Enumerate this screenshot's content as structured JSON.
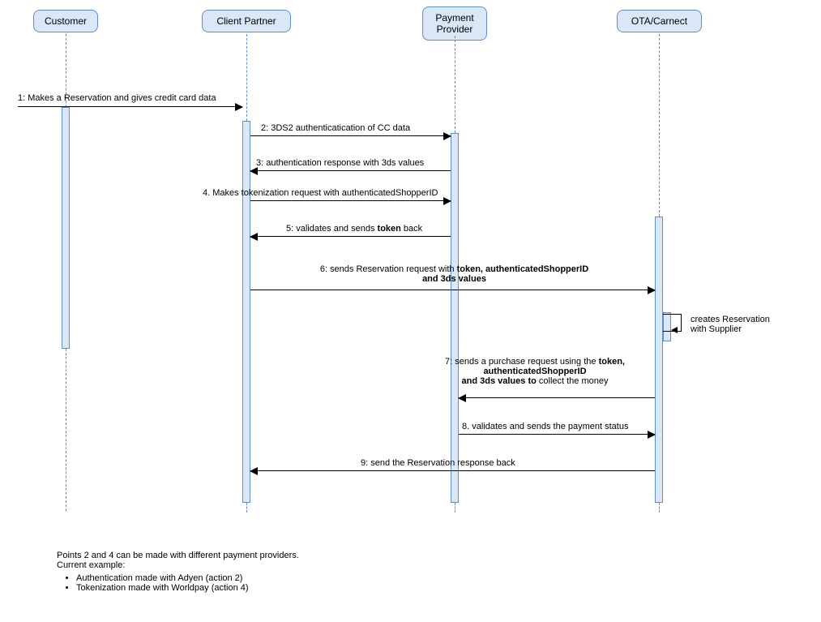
{
  "chart_data": {
    "type": "sequence-diagram",
    "participants": [
      "Customer",
      "Client Partner",
      "Payment Provider",
      "OTA/Carnect"
    ],
    "messages": [
      {
        "n": 1,
        "from": "Customer",
        "to": "Client Partner",
        "text": "1: Makes a Reservation and gives credit card data"
      },
      {
        "n": 2,
        "from": "Client Partner",
        "to": "Payment Provider",
        "text": "2: 3DS2 authenticatication of CC data"
      },
      {
        "n": 3,
        "from": "Payment Provider",
        "to": "Client Partner",
        "text": "3: authentication response with 3ds values"
      },
      {
        "n": 4,
        "from": "Client Partner",
        "to": "Payment Provider",
        "text": "4. Makes tokenization request with authenticatedShopperID"
      },
      {
        "n": 5,
        "from": "Payment Provider",
        "to": "Client Partner",
        "text": "5: validates and sends token back"
      },
      {
        "n": 6,
        "from": "Client Partner",
        "to": "OTA/Carnect",
        "text": "6: sends Reservation request with token, authenticatedShopperID and 3ds values"
      },
      {
        "n": -1,
        "from": "OTA/Carnect",
        "to": "OTA/Carnect",
        "text": "creates Reservation with Supplier"
      },
      {
        "n": 7,
        "from": "OTA/Carnect",
        "to": "Payment Provider",
        "text": "7: sends a purchase request using the token, authenticatedShopperID and 3ds values to collect the money"
      },
      {
        "n": 8,
        "from": "Payment Provider",
        "to": "OTA/Carnect",
        "text": "8. validates and sends the payment status"
      },
      {
        "n": 9,
        "from": "OTA/Carnect",
        "to": "Client Partner",
        "text": "9: send the Reservation response back"
      }
    ]
  },
  "p": {
    "customer": "Customer",
    "client": "Client Partner",
    "provider": "Payment\nProvider",
    "ota": "OTA/Carnect"
  },
  "m1": "1: Makes a Reservation and gives credit card data",
  "m2": "2: 3DS2 authenticatication of CC data",
  "m3": "3: authentication response with 3ds values",
  "m4": "4. Makes tokenization request with authenticatedShopperID",
  "m5_a": "5: validates and sends ",
  "m5_b": "token",
  "m5_c": " back",
  "m6_a": "6: sends Reservation request with ",
  "m6_b": "token, authenticatedShopperID",
  "m6_c": "and 3ds values",
  "self_a": "creates Reservation",
  "self_b": "with Supplier",
  "m7_a": "7: sends a purchase request using the ",
  "m7_b": "token,",
  "m7_c": "authenticatedShopperID",
  "m7_d": "and 3ds values to",
  "m7_e": " collect the money",
  "m8": "8. validates and sends the payment status",
  "m9": "9: send the Reservation response back",
  "note_intro": "Points 2 and 4 can be made with different payment providers.\nCurrent example:",
  "note_li1": "Authentication made with Adyen (action 2)",
  "note_li2": "Tokenization made with Worldpay (action 4)"
}
